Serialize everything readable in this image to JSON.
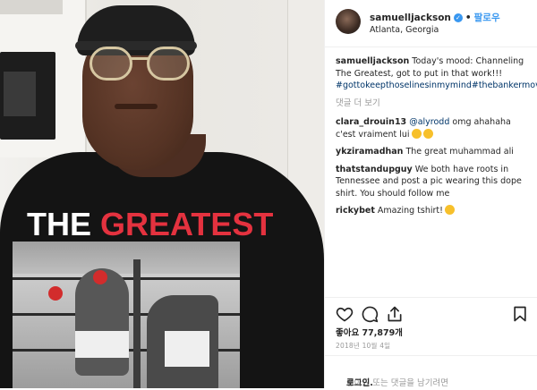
{
  "post": {
    "username": "samuelljackson",
    "follow_label": "팔로우",
    "location": "Atlanta, Georgia",
    "caption": "Today's mood: Channeling The Greatest, got to put in that work!!!",
    "hashtags": "#gottokeepthoselinesinmymind#thebankermovie",
    "more_comments": "댓글 더 보기",
    "comments": [
      {
        "user": "clara_drouin13",
        "mention": "@alyrodd",
        "text": "omg ahahaha c'est vraiment lui"
      },
      {
        "user": "ykziramadhan",
        "text": "The great muhammad ali"
      },
      {
        "user": "thatstandupguy",
        "text": "We both have roots in Tennessee and post a pic wearing this dope shirt. You should follow me"
      },
      {
        "user": "rickybet",
        "text": "Amazing tshirt!"
      }
    ],
    "likes": "좋아요 77,879개",
    "date": "2018년 10월 4일",
    "login_prompt": "좋아요 또는 댓글을 남기려면",
    "login_link": "로그인."
  },
  "photo": {
    "shirt_word1": "THE",
    "shirt_word2": "GREATEST"
  },
  "icons": [
    "verified-badge-icon",
    "heart-icon",
    "comment-icon",
    "share-icon",
    "bookmark-icon"
  ],
  "colors": {
    "link": "#3897f0",
    "hashtag": "#003569",
    "muted": "#999999",
    "shirt_red": "#e4323f"
  }
}
